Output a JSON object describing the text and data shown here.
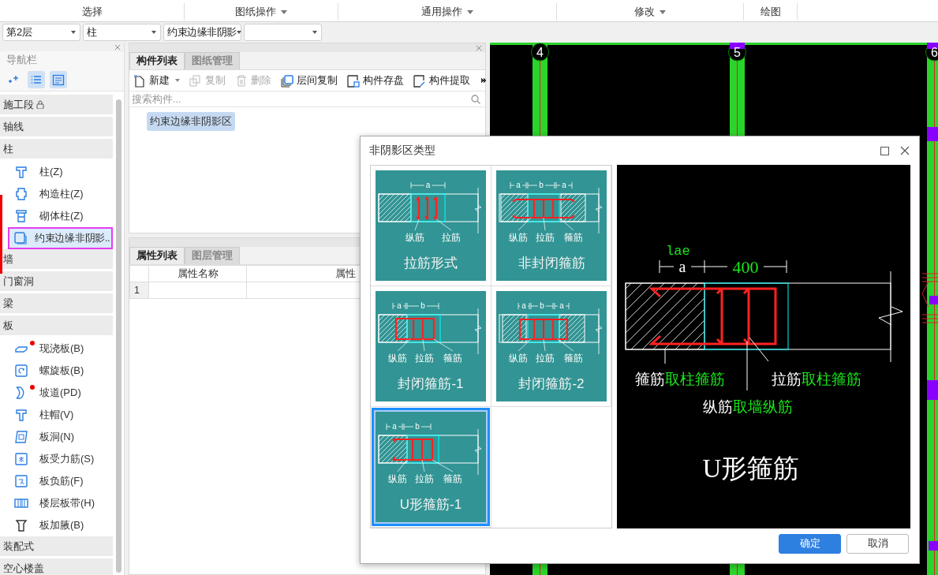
{
  "ribbon": [
    {
      "label": "选择",
      "has_menu": false
    },
    {
      "label": "图纸操作",
      "has_menu": true
    },
    {
      "label": "通用操作",
      "has_menu": true
    },
    {
      "label": "修改",
      "has_menu": true
    },
    {
      "label": "绘图",
      "has_menu": false
    }
  ],
  "selectors": [
    {
      "kind": "combo",
      "value": "第2层"
    },
    {
      "kind": "combo",
      "value": "柱"
    },
    {
      "kind": "combo",
      "value": "约束边缘非阴影"
    },
    {
      "kind": "combo"
    }
  ],
  "navigator": {
    "title": "导航栏",
    "view_buttons": [
      {
        "kind": "add",
        "selected": false
      },
      {
        "kind": "list",
        "selected": true
      },
      {
        "kind": "detail",
        "selected": true
      }
    ],
    "groups": [
      {
        "label": "施工段",
        "locked": true
      },
      {
        "label": "轴线",
        "locked": false
      },
      {
        "label": "柱",
        "locked": false,
        "children": [
          {
            "label": "柱(Z)",
            "selected": false,
            "has_dot": false
          },
          {
            "label": "构造柱(Z)",
            "selected": false,
            "has_dot": false
          },
          {
            "label": "砌体柱(Z)",
            "selected": false,
            "has_dot": false
          },
          {
            "label": "约束边缘非阴影..",
            "selected": true,
            "has_dot": false
          }
        ]
      },
      {
        "label": "墙",
        "locked": false
      },
      {
        "label": "门窗洞",
        "locked": false
      },
      {
        "label": "梁",
        "locked": false
      },
      {
        "label": "板",
        "locked": false,
        "children": [
          {
            "label": "现浇板(B)",
            "selected": false,
            "has_dot": true
          },
          {
            "label": "螺旋板(B)",
            "selected": false,
            "has_dot": false
          },
          {
            "label": "坡道(PD)",
            "selected": false,
            "has_dot": true
          },
          {
            "label": "柱帽(V)",
            "selected": false,
            "has_dot": false
          },
          {
            "label": "板洞(N)",
            "selected": false,
            "has_dot": false
          },
          {
            "label": "板受力筋(S)",
            "selected": false,
            "has_dot": false
          },
          {
            "label": "板负筋(F)",
            "selected": false,
            "has_dot": false
          },
          {
            "label": "楼层板带(H)",
            "selected": false,
            "has_dot": false
          },
          {
            "label": "板加腋(B)",
            "selected": false,
            "has_dot": false
          }
        ]
      },
      {
        "label": "装配式",
        "locked": false
      },
      {
        "label": "空心楼盖",
        "locked": false
      }
    ]
  },
  "component_panel": {
    "tabs": [
      {
        "label": "构件列表",
        "selected": true
      },
      {
        "label": "图纸管理",
        "selected": false
      }
    ],
    "toolbar": [
      {
        "kind": "new",
        "label": "新建",
        "disabled": false,
        "has_menu": true
      },
      {
        "kind": "copy",
        "label": "复制",
        "disabled": true,
        "has_menu": false
      },
      {
        "kind": "delete",
        "label": "删除",
        "disabled": true,
        "has_menu": false
      },
      {
        "kind": "floor-copy",
        "label": "层间复制",
        "disabled": false,
        "has_menu": false
      },
      {
        "kind": "save",
        "label": "构件存盘",
        "disabled": false,
        "has_menu": false
      },
      {
        "kind": "extract",
        "label": "构件提取",
        "disabled": false,
        "has_menu": false
      }
    ],
    "search": {
      "placeholder": "搜索构件..."
    },
    "items": [
      {
        "label": "约束边缘非阴影区",
        "selected": true
      }
    ]
  },
  "property_panel": {
    "tabs": [
      {
        "label": "属性列表",
        "selected": true
      },
      {
        "label": "图层管理",
        "selected": false
      }
    ],
    "columns": [
      "属性名称",
      "属性"
    ],
    "rows": [
      {
        "index": "1"
      }
    ]
  },
  "canvas": {
    "axis_labels": [
      "4",
      "5",
      "6"
    ]
  },
  "dialog": {
    "title": "非阴影区类型",
    "types": [
      {
        "kind": "tie",
        "dims": [
          "a"
        ],
        "labels": [
          "纵筋",
          "拉筋"
        ],
        "title": "拉筋形式",
        "selected": false
      },
      {
        "kind": "open",
        "dims": [
          "a",
          "b",
          "a"
        ],
        "labels": [
          "纵筋",
          "拉筋",
          "箍筋"
        ],
        "title": "非封闭箍筋",
        "selected": false
      },
      {
        "kind": "closed1",
        "dims": [
          "a",
          "b"
        ],
        "labels": [
          "纵筋",
          "拉筋",
          "箍筋"
        ],
        "title": "封闭箍筋-1",
        "selected": false
      },
      {
        "kind": "closed2",
        "dims": [
          "a",
          "b",
          "a"
        ],
        "labels": [
          "纵筋",
          "拉筋",
          "箍筋"
        ],
        "title": "封闭箍筋-2",
        "selected": false
      },
      {
        "kind": "u1",
        "dims": [
          "a",
          "b"
        ],
        "labels": [
          "纵筋",
          "拉筋",
          "箍筋"
        ],
        "title": "U形箍筋-1",
        "selected": true
      }
    ],
    "preview": {
      "anchor_label": "lae",
      "dims": [
        "a",
        "400"
      ],
      "callouts": [
        {
          "label": "箍筋",
          "source": "取柱箍筋"
        },
        {
          "label": "拉筋",
          "source": "取柱箍筋"
        },
        {
          "label": "纵筋",
          "source": "取墙纵筋"
        }
      ],
      "title": "U形箍筋"
    },
    "buttons": [
      {
        "kind": "primary",
        "label": "确定"
      },
      {
        "kind": "secondary",
        "label": "取消"
      }
    ]
  }
}
